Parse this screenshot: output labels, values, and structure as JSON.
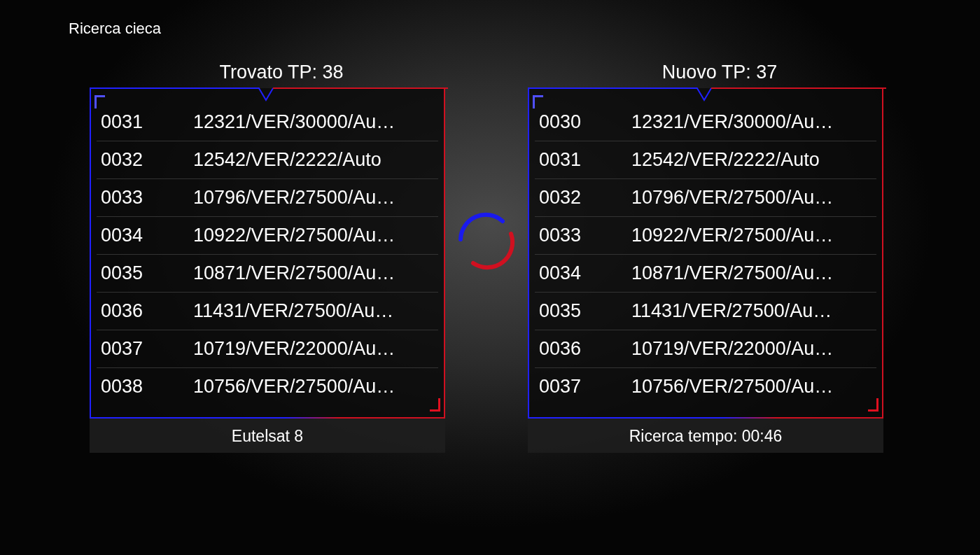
{
  "title": "Ricerca cieca",
  "panels": [
    {
      "heading": "Trovato TP: 38",
      "footer": "Eutelsat 8",
      "rows": [
        {
          "number": "0031",
          "params": "12321/VER/30000/Au…"
        },
        {
          "number": "0032",
          "params": "12542/VER/2222/Auto"
        },
        {
          "number": "0033",
          "params": "10796/VER/27500/Au…"
        },
        {
          "number": "0034",
          "params": "10922/VER/27500/Au…"
        },
        {
          "number": "0035",
          "params": "10871/VER/27500/Au…"
        },
        {
          "number": "0036",
          "params": "11431/VER/27500/Au…"
        },
        {
          "number": "0037",
          "params": "10719/VER/22000/Au…"
        },
        {
          "number": "0038",
          "params": "10756/VER/27500/Au…"
        }
      ]
    },
    {
      "heading": "Nuovo TP: 37",
      "footer": "Ricerca tempo: 00:46",
      "rows": [
        {
          "number": "0030",
          "params": "12321/VER/30000/Au…"
        },
        {
          "number": "0031",
          "params": "12542/VER/2222/Auto"
        },
        {
          "number": "0032",
          "params": "10796/VER/27500/Au…"
        },
        {
          "number": "0033",
          "params": "10922/VER/27500/Au…"
        },
        {
          "number": "0034",
          "params": "10871/VER/27500/Au…"
        },
        {
          "number": "0035",
          "params": "11431/VER/27500/Au…"
        },
        {
          "number": "0036",
          "params": "10719/VER/22000/Au…"
        },
        {
          "number": "0037",
          "params": "10756/VER/27500/Au…"
        }
      ]
    }
  ]
}
